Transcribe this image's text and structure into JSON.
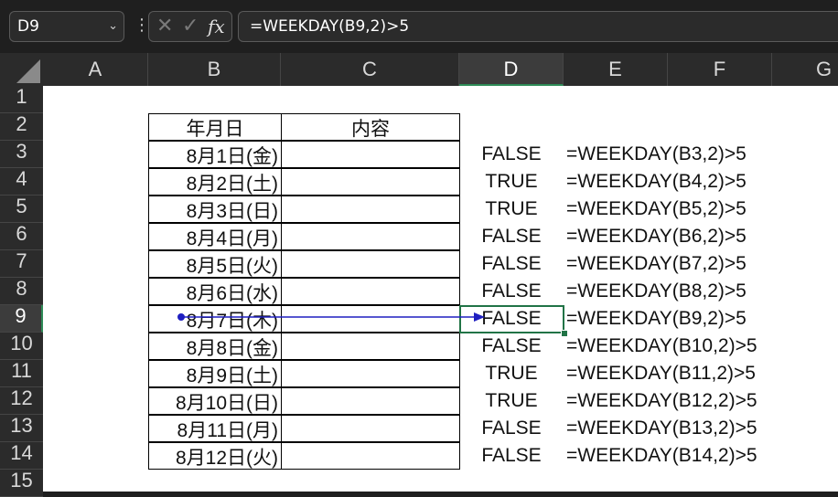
{
  "name_box": {
    "value": "D9",
    "dropdown_icon": "chevron-down-icon"
  },
  "formula_bar": {
    "more_icon": "vertical-dots-icon",
    "cancel_icon": "x-icon",
    "enter_icon": "check-icon",
    "function_icon": "fx-icon",
    "formula": "=WEEKDAY(B9,2)>5"
  },
  "columns": [
    "A",
    "B",
    "C",
    "D",
    "E",
    "F",
    "G"
  ],
  "selected_column": "D",
  "rows": [
    "1",
    "2",
    "3",
    "4",
    "5",
    "6",
    "7",
    "8",
    "9",
    "10",
    "11",
    "12",
    "13",
    "14",
    "15"
  ],
  "selected_row": "9",
  "table_header": {
    "date": "年月日",
    "content": "内容"
  },
  "dates": [
    "8月1日(金)",
    "8月2日(土)",
    "8月3日(日)",
    "8月4日(月)",
    "8月5日(火)",
    "8月6日(水)",
    "8月7日(木)",
    "8月8日(金)",
    "8月9日(土)",
    "8月10日(日)",
    "8月11日(月)",
    "8月12日(火)"
  ],
  "results": [
    "FALSE",
    "TRUE",
    "TRUE",
    "FALSE",
    "FALSE",
    "FALSE",
    "FALSE",
    "FALSE",
    "TRUE",
    "TRUE",
    "FALSE",
    "FALSE"
  ],
  "formulas": [
    "=WEEKDAY(B3,2)>5",
    "=WEEKDAY(B4,2)>5",
    "=WEEKDAY(B5,2)>5",
    "=WEEKDAY(B6,2)>5",
    "=WEEKDAY(B7,2)>5",
    "=WEEKDAY(B8,2)>5",
    "=WEEKDAY(B9,2)>5",
    "=WEEKDAY(B10,2)>5",
    "=WEEKDAY(B11,2)>5",
    "=WEEKDAY(B12,2)>5",
    "=WEEKDAY(B13,2)>5",
    "=WEEKDAY(B14,2)>5"
  ],
  "colors": {
    "selection": "#217346",
    "trace_arrow": "#1f1fc0"
  }
}
